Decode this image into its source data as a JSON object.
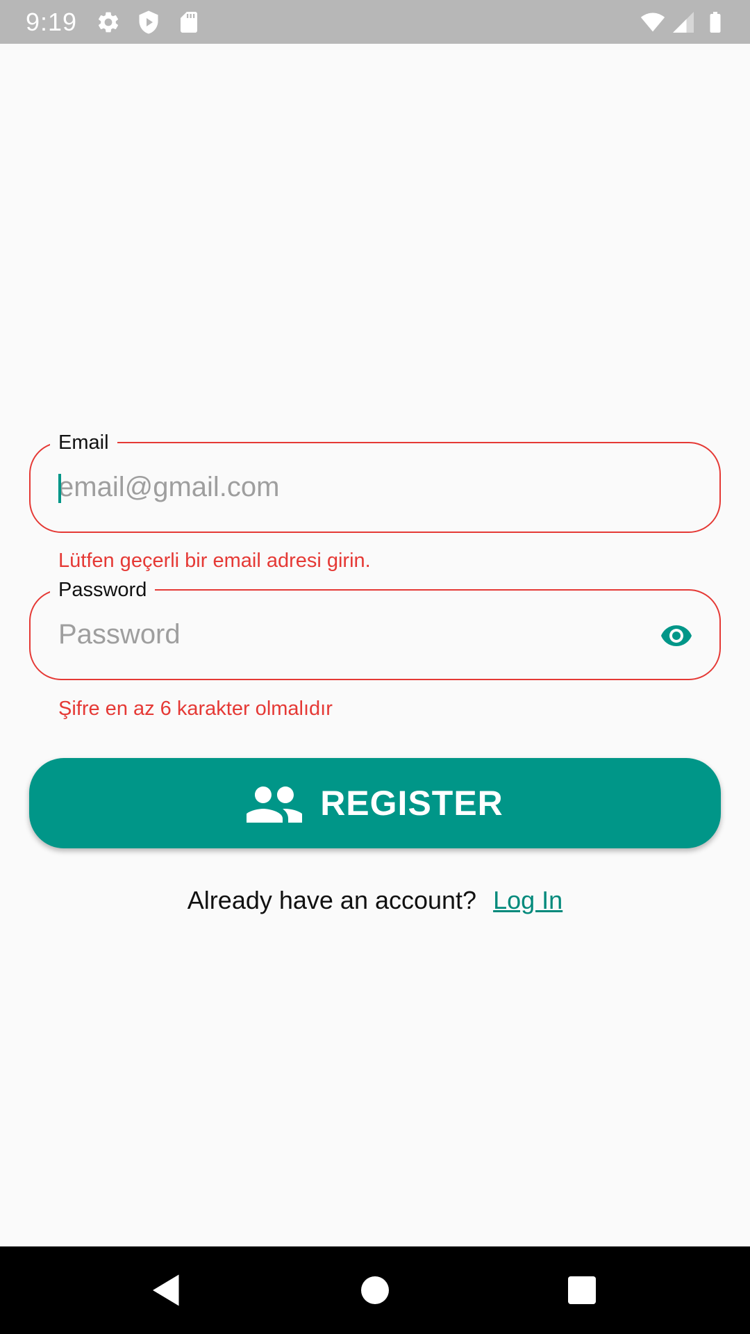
{
  "status_bar": {
    "time": "9:19",
    "icons": [
      "settings-icon",
      "shield-play-icon",
      "sd-card-icon",
      "wifi-icon",
      "cell-signal-icon",
      "battery-icon"
    ]
  },
  "form": {
    "email": {
      "label": "Email",
      "value": "",
      "placeholder": "email@gmail.com",
      "error": "Lütfen geçerli bir email adresi girin."
    },
    "password": {
      "label": "Password",
      "value": "",
      "placeholder": "Password",
      "error": "Şifre en az 6 karakter olmalıdır",
      "toggle_icon": "eye-icon"
    },
    "register": {
      "label": "REGISTER",
      "icon": "people-icon"
    },
    "login_prompt": {
      "text": "Already have an account?",
      "link": "Log In"
    }
  },
  "nav_bar": {
    "buttons": [
      "back-icon",
      "home-icon",
      "recents-icon"
    ]
  },
  "colors": {
    "accent": "#009688",
    "error": "#e53935",
    "status_bar": "#b7b7b7",
    "background": "#fafafa"
  }
}
